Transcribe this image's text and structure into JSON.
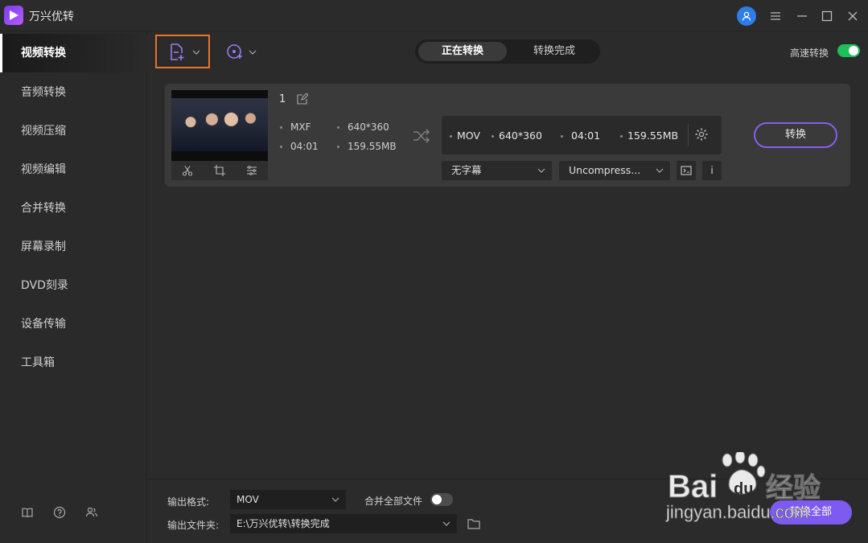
{
  "app": {
    "title": "万兴优转"
  },
  "titlebar": {
    "icons": [
      "user-icon",
      "menu-icon",
      "minimize-icon",
      "maximize-icon",
      "close-icon"
    ]
  },
  "sidebar": {
    "items": [
      {
        "label": "视频转换",
        "active": true
      },
      {
        "label": "音频转换"
      },
      {
        "label": "视频压缩"
      },
      {
        "label": "视频编辑"
      },
      {
        "label": "合并转换"
      },
      {
        "label": "屏幕录制"
      },
      {
        "label": "DVD刻录"
      },
      {
        "label": "设备传输"
      },
      {
        "label": "工具箱"
      }
    ],
    "bottom_icons": [
      "book-icon",
      "help-icon",
      "account-icon"
    ]
  },
  "toolbar": {
    "tabs": [
      {
        "label": "正在转换",
        "active": true
      },
      {
        "label": "转换完成"
      }
    ],
    "high_speed_label": "高速转换",
    "high_speed_on": true,
    "accent_color": "#e8732a"
  },
  "file": {
    "index": "1",
    "source": {
      "format": "MXF",
      "resolution": "640*360",
      "duration": "04:01",
      "size": "159.55MB"
    },
    "target": {
      "format": "MOV",
      "resolution": "640*360",
      "duration": "04:01",
      "size": "159.55MB"
    },
    "subtitle": "无字幕",
    "audio": "Uncompress...",
    "info_glyph": "i",
    "convert_label": "转换"
  },
  "bottom": {
    "format_label": "输出格式:",
    "format_value": "MOV",
    "merge_label": "合并全部文件",
    "merge_on": false,
    "folder_label": "输出文件夹:",
    "folder_value": "E:\\万兴优转\\转换完成",
    "convert_all_label": "转换全部"
  },
  "watermark": {
    "brand": "Bai",
    "brand_suffix": "du",
    "product": "经验",
    "url": "jingyan.baidu.com"
  },
  "colors": {
    "brand_purple": "#7d5bf0",
    "toggle_green": "#1fbf5a",
    "user_blue": "#2f7dea"
  }
}
